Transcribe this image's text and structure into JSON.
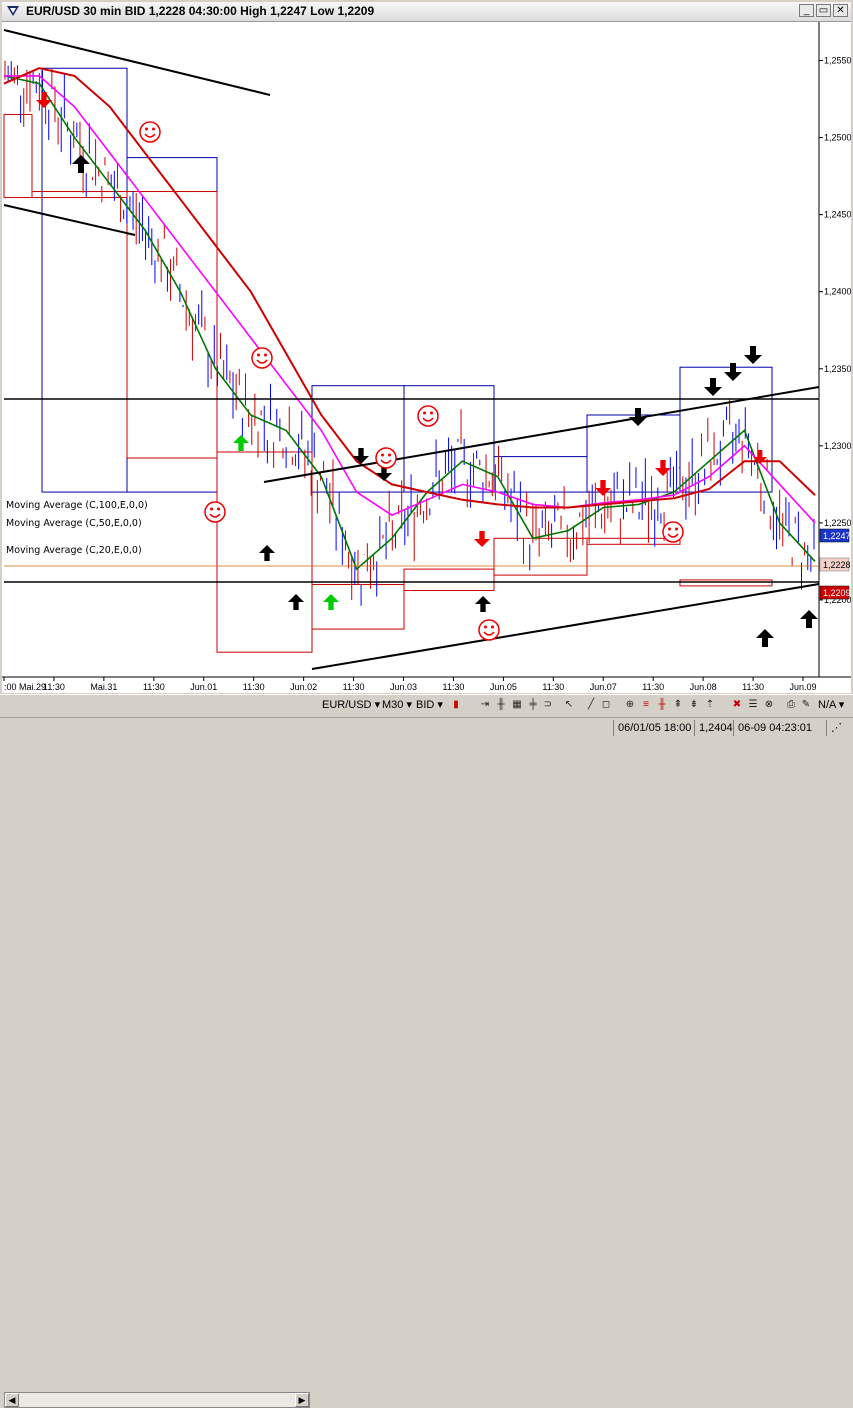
{
  "window": {
    "title": "EUR/USD 30 min BID 1,2228 04:30:00 High 1,2247 Low 1,2209",
    "buttons": [
      "_",
      "▭",
      "✕"
    ]
  },
  "legend": [
    "Moving Average (C,100,E,0,0)",
    "Moving Average (C,50,E,0,0)",
    "Moving Average (C,20,E,0,0)"
  ],
  "price_tags": {
    "ma_value": "1,2247",
    "bid": "1,2228",
    "low": "1,2209"
  },
  "toolbar": {
    "symbol": "EUR/USD",
    "period": "M30",
    "side": "BID",
    "na": "N/A"
  },
  "status": {
    "cursor_time": "06/01/05 18:00",
    "cursor_price": "1,2404",
    "server_time": "06-09 04:23:01"
  },
  "colors": {
    "background": "#ffffff",
    "candles": "#0000ff",
    "ma100": "#cc0000",
    "ma50": "#ff00ff",
    "ma20": "#007700",
    "box_blue": "#0000aa",
    "box_red": "#cc0000"
  },
  "chart_data": {
    "type": "line",
    "instrument": "EUR/USD",
    "timeframe": "30 min",
    "title": "EUR/USD 30 min BID 1,2228 04:30:00 High 1,2247 Low 1,2209",
    "y_ticks": [
      "1,2550",
      "1,2500",
      "1,2450",
      "1,2400",
      "1,2350",
      "1,2300",
      "1,2250",
      "1,2200"
    ],
    "x_ticks": [
      ":00 Mai.29",
      "11:30",
      "Mai.31",
      "11:30",
      "Jun.01",
      "11:30",
      "Jun.02",
      "11:30",
      "Jun.03",
      "11:30",
      "Jun.05",
      "11:30",
      "Jun.07",
      "11:30",
      "Jun.08",
      "11:30",
      "Jun.09"
    ],
    "ylim": [
      1.215,
      1.2575
    ],
    "series": [
      {
        "name": "Moving Average (C,20,E,0,0)",
        "values": [
          1.254,
          1.2535,
          1.25,
          1.247,
          1.244,
          1.24,
          1.235,
          1.232,
          1.231,
          1.228,
          1.222,
          1.224,
          1.227,
          1.229,
          1.228,
          1.224,
          1.2245,
          1.226,
          1.2262,
          1.227,
          1.229,
          1.231,
          1.225,
          1.2225
        ]
      },
      {
        "name": "Moving Average (C,50,E,0,0)",
        "values": [
          1.254,
          1.254,
          1.252,
          1.249,
          1.246,
          1.243,
          1.24,
          1.237,
          1.234,
          1.231,
          1.227,
          1.2255,
          1.2265,
          1.2275,
          1.227,
          1.2262,
          1.226,
          1.2263,
          1.2265,
          1.2268,
          1.228,
          1.23,
          1.2275,
          1.225
        ]
      },
      {
        "name": "Moving Average (C,100,E,0,0)",
        "values": [
          1.2535,
          1.2545,
          1.254,
          1.252,
          1.249,
          1.246,
          1.243,
          1.24,
          1.236,
          1.232,
          1.229,
          1.2275,
          1.227,
          1.2265,
          1.2262,
          1.226,
          1.226,
          1.2262,
          1.2264,
          1.2266,
          1.2272,
          1.229,
          1.229,
          1.2268
        ]
      }
    ],
    "grid": false,
    "legend_position": "bottom-left"
  }
}
